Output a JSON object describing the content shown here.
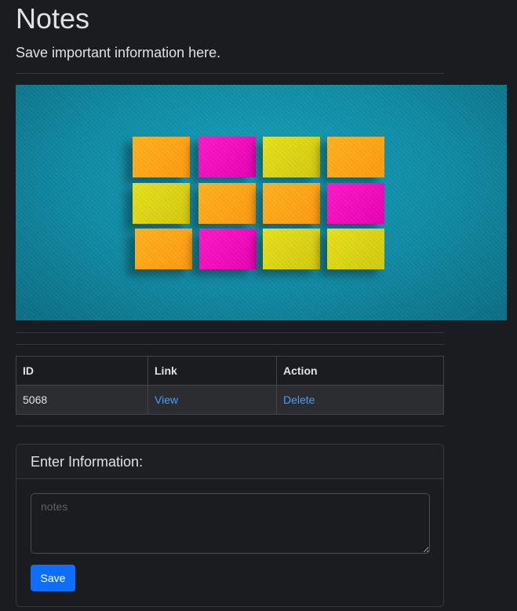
{
  "header": {
    "title": "Notes",
    "subtitle": "Save important information here."
  },
  "hero_image": {
    "description_icon": "sticky-notes-image",
    "colors": {
      "background": "#16a2bd",
      "orange": "#ffa31a",
      "magenta": "#f20cbd",
      "yellow": "#ddd515"
    }
  },
  "table": {
    "columns": [
      "ID",
      "Link",
      "Action"
    ],
    "rows": [
      {
        "id": "5068",
        "link": "View",
        "action": "Delete"
      }
    ]
  },
  "form": {
    "heading": "Enter Information:",
    "textarea_placeholder": "notes",
    "textarea_value": "",
    "submit_label": "Save"
  },
  "colors": {
    "accent": "#0d6efd",
    "link": "#4b9cf5",
    "background": "#1b1c1f"
  }
}
